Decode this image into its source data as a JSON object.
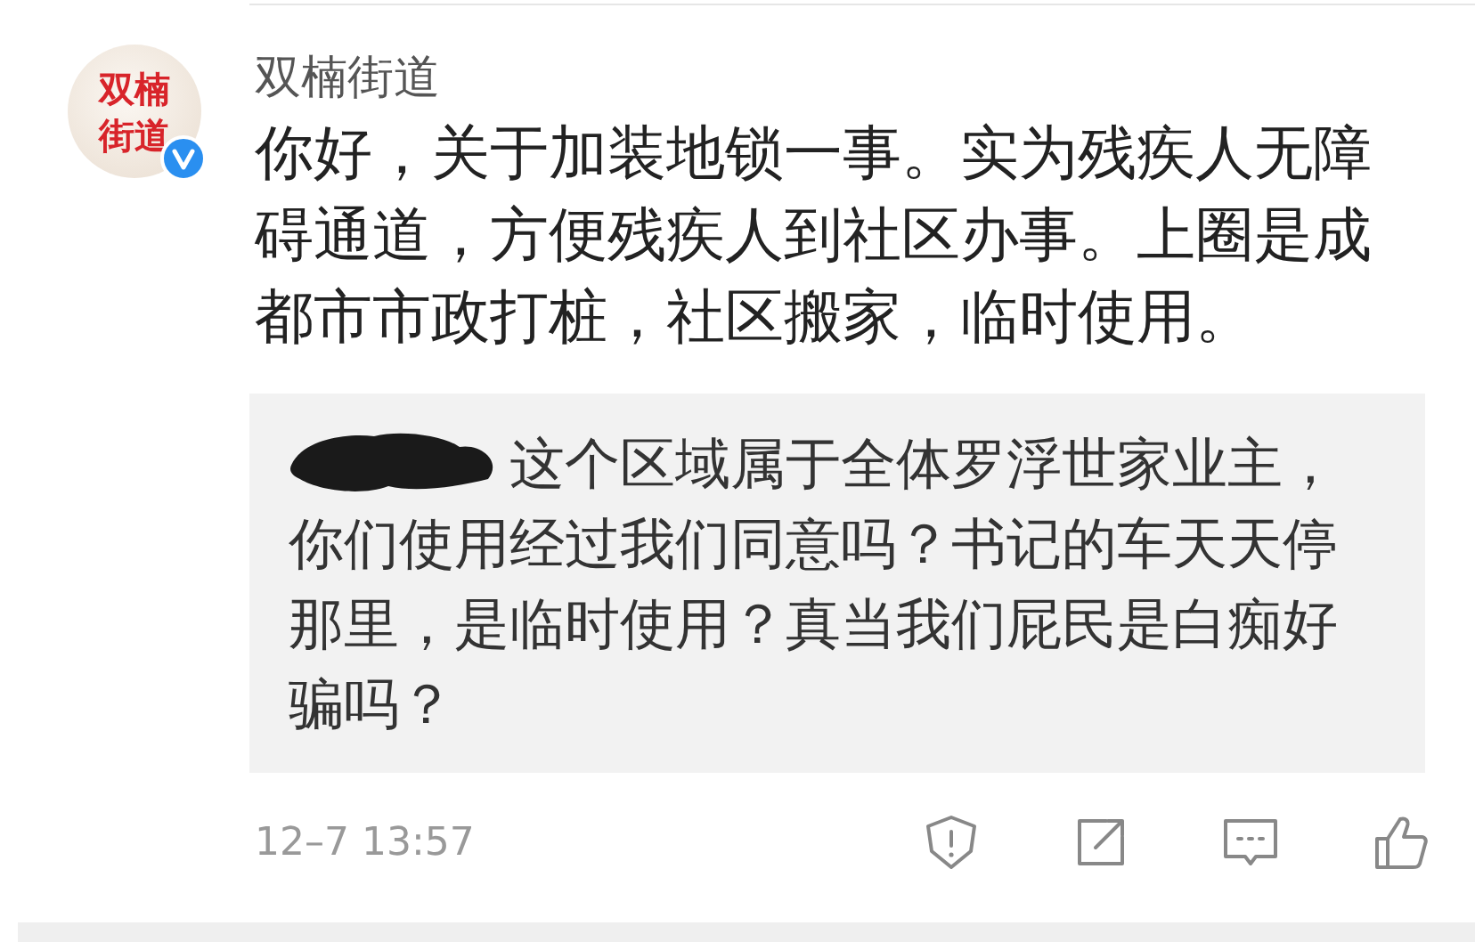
{
  "comment": {
    "avatar_text": "双楠街道",
    "verified": true,
    "author": "双楠街道",
    "body": "你好，关于加装地锁一事。实为残疾人无障碍通道，方便残疾人到社区办事。上圈是成都市市政打桩，社区搬家，临时使用。",
    "quoted_reply": {
      "author_redacted": true,
      "text": "这个区域属于全体罗浮世家业主，你们使用经过我们同意吗？书记的车天天停那里，是临时使用？真当我们屁民是白痴好骗吗？"
    },
    "time": "12–7 13:57"
  }
}
